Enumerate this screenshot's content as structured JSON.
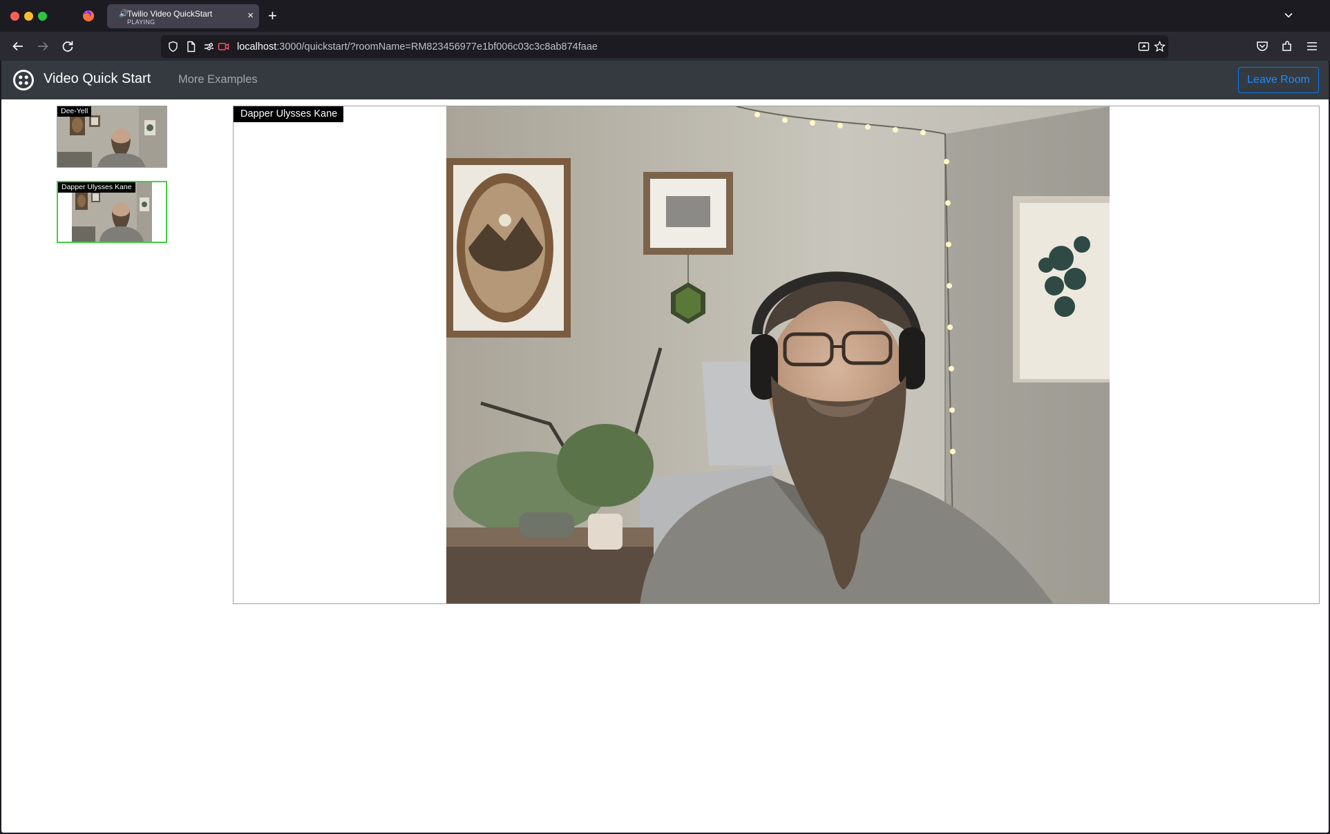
{
  "browser": {
    "tab": {
      "title": "Twilio Video QuickStart",
      "status": "PLAYING",
      "speaker_glyph": "🔊",
      "close_glyph": "×"
    },
    "new_tab_glyph": "+",
    "url": {
      "host": "localhost",
      "path": ":3000/quickstart/?roomName=RM823456977e1bf006c03c3c8ab874faae"
    }
  },
  "app": {
    "brand": "Video Quick Start",
    "nav_link": "More Examples",
    "leave_button": "Leave Room",
    "accent_color": "#007bff",
    "active_border_color": "#40d040"
  },
  "participants": [
    {
      "name": "Dee-Yell",
      "active": false
    },
    {
      "name": "Dapper Ulysses Kane",
      "active": true
    }
  ],
  "main_video": {
    "participant": "Dapper Ulysses Kane"
  }
}
